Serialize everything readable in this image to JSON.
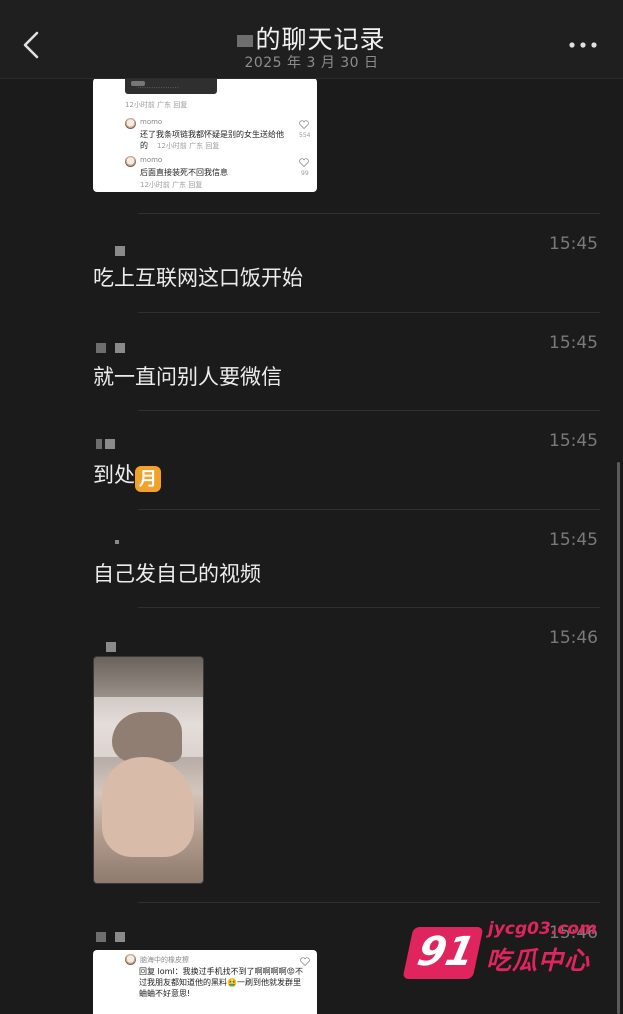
{
  "header": {
    "title": "的聊天记录",
    "subtitle": "2025 年 3 月 30 日"
  },
  "top_card": {
    "meta1": "12小时前 广东 回复",
    "comment1_name": "momo",
    "comment1_text": "还了我条项链我都怀疑是别的女生送给他的",
    "comment1_meta": "12小时前 广东 回复",
    "comment1_likes": "554",
    "comment2_name": "momo",
    "comment2_text": "后面直接装死不回我信息",
    "comment2_meta": "12小时前 广东 回复",
    "comment2_likes": "99"
  },
  "messages": [
    {
      "time": "15:45",
      "text": "吃上互联网这口饭开始"
    },
    {
      "time": "15:45",
      "text": "就一直问别人要微信"
    },
    {
      "time": "15:45",
      "text": "到处",
      "emoji": "月"
    },
    {
      "time": "15:45",
      "text": "自己发自己的视频"
    },
    {
      "time": "15:46"
    },
    {
      "time": "15:46"
    }
  ],
  "bottom_card": {
    "name": "脑海中的橡皮擦",
    "reply": "回复 loml：我换过手机找不到了啊啊啊啊😡不过我朋友都知道他的黑料🤮一刷到他就发群里蛐蛐不好意思!"
  },
  "watermark": {
    "logo": "91",
    "url": "jycg03.com",
    "name": "吃瓜中心"
  },
  "colors": {
    "background": "#1b1b1b",
    "header": "#1f1f1f",
    "text": "#ececec",
    "time": "#7a7a7a",
    "watermark": "#e0245e"
  },
  "icons": [
    "back-icon",
    "more-icon",
    "heart-icon"
  ]
}
